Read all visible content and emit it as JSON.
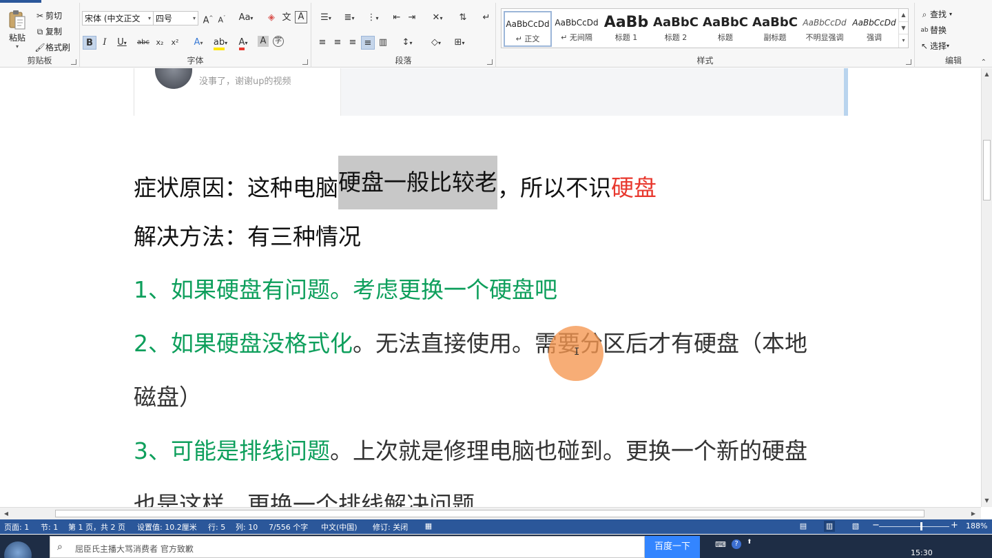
{
  "ribbon": {
    "clipboard": {
      "paste": "粘贴",
      "cut": "剪切",
      "copy": "复制",
      "format_painter": "格式刷",
      "group_label": "剪贴板"
    },
    "font": {
      "font_name": "宋体 (中文正文",
      "font_size": "四号",
      "grow": "A",
      "shrink": "A",
      "change_case": "Aa",
      "bold": "B",
      "italic": "I",
      "underline": "U",
      "strikethrough": "abc",
      "subscript": "x₂",
      "superscript": "x²",
      "group_label": "字体"
    },
    "paragraph": {
      "group_label": "段落"
    },
    "styles": {
      "group_label": "样式",
      "items": [
        {
          "sample": "AaBbCcDd",
          "name": "↵ 正文"
        },
        {
          "sample": "AaBbCcDd",
          "name": "↵ 无间隔"
        },
        {
          "sample": "AaBb",
          "name": "标题 1"
        },
        {
          "sample": "AaBbC",
          "name": "标题 2"
        },
        {
          "sample": "AaBbC",
          "name": "标题"
        },
        {
          "sample": "AaBbC",
          "name": "副标题"
        },
        {
          "sample": "AaBbCcDd",
          "name": "不明显强调"
        },
        {
          "sample": "AaBbCcDd",
          "name": "强调"
        }
      ]
    },
    "editing": {
      "find": "查找",
      "replace": "替换",
      "select": "选择",
      "group_label": "编辑"
    }
  },
  "embed": {
    "comment": "没事了，谢谢up的视频"
  },
  "document": {
    "line1_pre": "症状原因：这种电脑",
    "line1_hl": "硬盘一般比较老",
    "line1_post": "，所以不识",
    "line1_red": "硬盘",
    "line2": "解决方法：有三种情况",
    "line3": "1、如果硬盘有问题。考虑更换一个硬盘吧",
    "line4_green": "2、如果硬盘没格式化",
    "line4_rest": "。无法直接使用。需要分区后才有硬盘（本地",
    "line5": "磁盘）",
    "line6_green": "3、可能是排线问题",
    "line6_rest": "。上次就是修理电脑也碰到。更换一个新的硬盘",
    "line7": "也是这样。更换一个排线解决问题"
  },
  "statusbar": {
    "page": "页面: 1",
    "section": "节: 1",
    "page_of": "第 1 页，共 2 页",
    "at": "设置值: 10.2厘米",
    "row": "行: 5",
    "col": "列: 10",
    "words": "7/556 个字",
    "lang": "中文(中国)",
    "track": "修订: 关闭",
    "zoom_minus": "−",
    "zoom_plus": "+",
    "zoom": "188%",
    "zoom_level": 0.6
  },
  "taskbar": {
    "search_text": "屈臣氏主播大骂消费者 官方致歉",
    "search_button": "百度一下",
    "time": "15:30"
  },
  "colors": {
    "accent": "#2b579a",
    "green_text": "#0e9f5c",
    "red_text": "#e8382e",
    "highlight": "#c8c8c8",
    "cursor_blob": "#f59650"
  }
}
